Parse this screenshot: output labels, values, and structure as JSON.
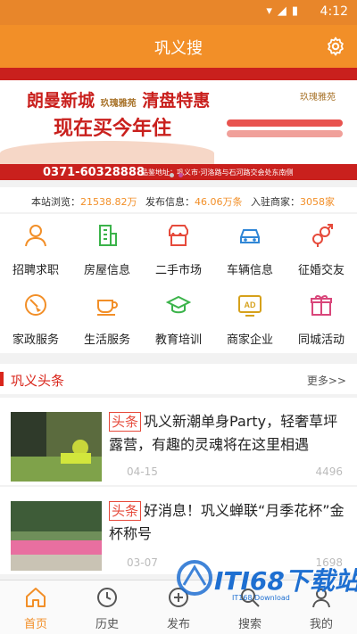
{
  "status_bar": {
    "time": "4:12",
    "icons": [
      "wifi-icon",
      "signal-icon",
      "battery-icon"
    ]
  },
  "header": {
    "title": "巩义搜",
    "settings_icon": "gear-icon"
  },
  "banner": {
    "headline_1": "朗曼新城",
    "brand_small": "玖瑰雅苑",
    "headline_1b": "清盘特惠",
    "headline_2": "现在买今年住",
    "phone": "0371-60328888",
    "address": "品鉴地址：巩义市·河洛路与石河路交会处东南侧",
    "logo_text": "玖瑰雅苑",
    "pager": {
      "count": 2,
      "active": 1
    }
  },
  "stats": {
    "browse_label": "本站浏览：",
    "browse_value": "21538.82万",
    "post_label": "发布信息：",
    "post_value": "46.06万条",
    "merchant_label": "入驻商家：",
    "merchant_value": "3058家"
  },
  "categories": [
    {
      "label": "招聘求职",
      "icon": "person-icon",
      "color": "#f28f28"
    },
    {
      "label": "房屋信息",
      "icon": "building-icon",
      "color": "#3bb34a"
    },
    {
      "label": "二手市场",
      "icon": "shop-icon",
      "color": "#e64a3b"
    },
    {
      "label": "车辆信息",
      "icon": "car-icon",
      "color": "#2f86d6"
    },
    {
      "label": "征婚交友",
      "icon": "gender-icon",
      "color": "#e64a3b"
    },
    {
      "label": "家政服务",
      "icon": "broom-icon",
      "color": "#f28f28"
    },
    {
      "label": "生活服务",
      "icon": "cup-icon",
      "color": "#f28f28"
    },
    {
      "label": "教育培训",
      "icon": "graduation-cap-icon",
      "color": "#3bb34a"
    },
    {
      "label": "商家企业",
      "icon": "ad-icon",
      "color": "#d6a11b"
    },
    {
      "label": "同城活动",
      "icon": "gift-icon",
      "color": "#d9467a"
    }
  ],
  "news_section": {
    "title": "巩义头条",
    "more": "更多>>"
  },
  "news": [
    {
      "tag": "头条",
      "title": "巩义新潮单身Party，轻奢草坪露营，有趣的灵魂将在这里相遇",
      "date": "04-15",
      "views": "4496"
    },
    {
      "tag": "头条",
      "title": "好消息！巩义蝉联“月季花杯”金杯称号",
      "date": "03-07",
      "views": "1698"
    }
  ],
  "tabs": [
    {
      "label": "首页",
      "icon": "home-icon",
      "active": true
    },
    {
      "label": "历史",
      "icon": "clock-icon",
      "active": false
    },
    {
      "label": "发布",
      "icon": "plus-icon",
      "active": false
    },
    {
      "label": "搜索",
      "icon": "search-icon",
      "active": false
    },
    {
      "label": "我的",
      "icon": "user-icon",
      "active": false
    }
  ],
  "watermark": {
    "text": "ITI68下载站",
    "sub": "IT168 Download"
  },
  "colors": {
    "accent": "#f28f28",
    "headline_red": "#d9261c",
    "banner_red": "#c9201d"
  }
}
